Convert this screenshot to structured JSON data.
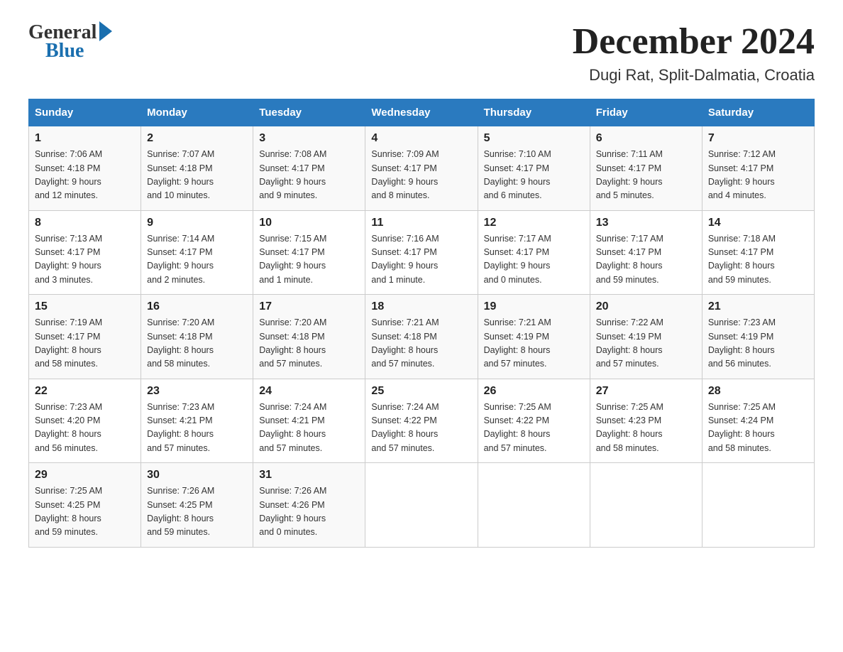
{
  "header": {
    "logo_general": "General",
    "logo_blue": "Blue",
    "month_title": "December 2024",
    "location": "Dugi Rat, Split-Dalmatia, Croatia"
  },
  "days_of_week": [
    "Sunday",
    "Monday",
    "Tuesday",
    "Wednesday",
    "Thursday",
    "Friday",
    "Saturday"
  ],
  "weeks": [
    [
      {
        "day": "1",
        "sunrise": "7:06 AM",
        "sunset": "4:18 PM",
        "daylight": "9 hours and 12 minutes."
      },
      {
        "day": "2",
        "sunrise": "7:07 AM",
        "sunset": "4:18 PM",
        "daylight": "9 hours and 10 minutes."
      },
      {
        "day": "3",
        "sunrise": "7:08 AM",
        "sunset": "4:17 PM",
        "daylight": "9 hours and 9 minutes."
      },
      {
        "day": "4",
        "sunrise": "7:09 AM",
        "sunset": "4:17 PM",
        "daylight": "9 hours and 8 minutes."
      },
      {
        "day": "5",
        "sunrise": "7:10 AM",
        "sunset": "4:17 PM",
        "daylight": "9 hours and 6 minutes."
      },
      {
        "day": "6",
        "sunrise": "7:11 AM",
        "sunset": "4:17 PM",
        "daylight": "9 hours and 5 minutes."
      },
      {
        "day": "7",
        "sunrise": "7:12 AM",
        "sunset": "4:17 PM",
        "daylight": "9 hours and 4 minutes."
      }
    ],
    [
      {
        "day": "8",
        "sunrise": "7:13 AM",
        "sunset": "4:17 PM",
        "daylight": "9 hours and 3 minutes."
      },
      {
        "day": "9",
        "sunrise": "7:14 AM",
        "sunset": "4:17 PM",
        "daylight": "9 hours and 2 minutes."
      },
      {
        "day": "10",
        "sunrise": "7:15 AM",
        "sunset": "4:17 PM",
        "daylight": "9 hours and 1 minute."
      },
      {
        "day": "11",
        "sunrise": "7:16 AM",
        "sunset": "4:17 PM",
        "daylight": "9 hours and 1 minute."
      },
      {
        "day": "12",
        "sunrise": "7:17 AM",
        "sunset": "4:17 PM",
        "daylight": "9 hours and 0 minutes."
      },
      {
        "day": "13",
        "sunrise": "7:17 AM",
        "sunset": "4:17 PM",
        "daylight": "8 hours and 59 minutes."
      },
      {
        "day": "14",
        "sunrise": "7:18 AM",
        "sunset": "4:17 PM",
        "daylight": "8 hours and 59 minutes."
      }
    ],
    [
      {
        "day": "15",
        "sunrise": "7:19 AM",
        "sunset": "4:17 PM",
        "daylight": "8 hours and 58 minutes."
      },
      {
        "day": "16",
        "sunrise": "7:20 AM",
        "sunset": "4:18 PM",
        "daylight": "8 hours and 58 minutes."
      },
      {
        "day": "17",
        "sunrise": "7:20 AM",
        "sunset": "4:18 PM",
        "daylight": "8 hours and 57 minutes."
      },
      {
        "day": "18",
        "sunrise": "7:21 AM",
        "sunset": "4:18 PM",
        "daylight": "8 hours and 57 minutes."
      },
      {
        "day": "19",
        "sunrise": "7:21 AM",
        "sunset": "4:19 PM",
        "daylight": "8 hours and 57 minutes."
      },
      {
        "day": "20",
        "sunrise": "7:22 AM",
        "sunset": "4:19 PM",
        "daylight": "8 hours and 57 minutes."
      },
      {
        "day": "21",
        "sunrise": "7:23 AM",
        "sunset": "4:19 PM",
        "daylight": "8 hours and 56 minutes."
      }
    ],
    [
      {
        "day": "22",
        "sunrise": "7:23 AM",
        "sunset": "4:20 PM",
        "daylight": "8 hours and 56 minutes."
      },
      {
        "day": "23",
        "sunrise": "7:23 AM",
        "sunset": "4:21 PM",
        "daylight": "8 hours and 57 minutes."
      },
      {
        "day": "24",
        "sunrise": "7:24 AM",
        "sunset": "4:21 PM",
        "daylight": "8 hours and 57 minutes."
      },
      {
        "day": "25",
        "sunrise": "7:24 AM",
        "sunset": "4:22 PM",
        "daylight": "8 hours and 57 minutes."
      },
      {
        "day": "26",
        "sunrise": "7:25 AM",
        "sunset": "4:22 PM",
        "daylight": "8 hours and 57 minutes."
      },
      {
        "day": "27",
        "sunrise": "7:25 AM",
        "sunset": "4:23 PM",
        "daylight": "8 hours and 58 minutes."
      },
      {
        "day": "28",
        "sunrise": "7:25 AM",
        "sunset": "4:24 PM",
        "daylight": "8 hours and 58 minutes."
      }
    ],
    [
      {
        "day": "29",
        "sunrise": "7:25 AM",
        "sunset": "4:25 PM",
        "daylight": "8 hours and 59 minutes."
      },
      {
        "day": "30",
        "sunrise": "7:26 AM",
        "sunset": "4:25 PM",
        "daylight": "8 hours and 59 minutes."
      },
      {
        "day": "31",
        "sunrise": "7:26 AM",
        "sunset": "4:26 PM",
        "daylight": "9 hours and 0 minutes."
      },
      null,
      null,
      null,
      null
    ]
  ],
  "labels": {
    "sunrise": "Sunrise:",
    "sunset": "Sunset:",
    "daylight": "Daylight:"
  }
}
